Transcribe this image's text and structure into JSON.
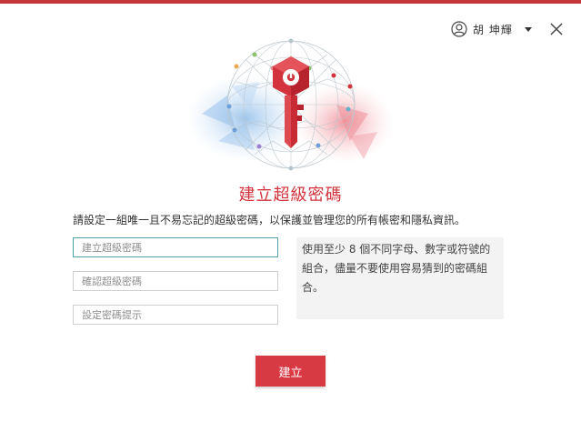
{
  "user": {
    "name": "胡 坤輝"
  },
  "title": "建立超級密碼",
  "subtitle": "請設定一組唯一且不易忘記的超級密碼，以保護並管理您的所有帳密和隱私資訊。",
  "fields": {
    "master_password_placeholder": "建立超級密碼",
    "confirm_password_placeholder": "確認超級密碼",
    "hint_placeholder": "設定密碼提示"
  },
  "hint_text": "使用至少 8 個不同字母、數字或符號的組合，儘量不要使用容易猜到的密碼組合。",
  "create_button_label": "建立",
  "colors": {
    "accent": "#d2333c",
    "top_bar": "#c8363d",
    "button": "#d83a44",
    "focus_border": "#4aa3a8",
    "hint_bg": "#f3f3f3"
  },
  "icons": {
    "avatar": "user-avatar-icon",
    "caret": "caret-down-icon",
    "close": "close-icon",
    "logo": "key-logo-icon"
  }
}
